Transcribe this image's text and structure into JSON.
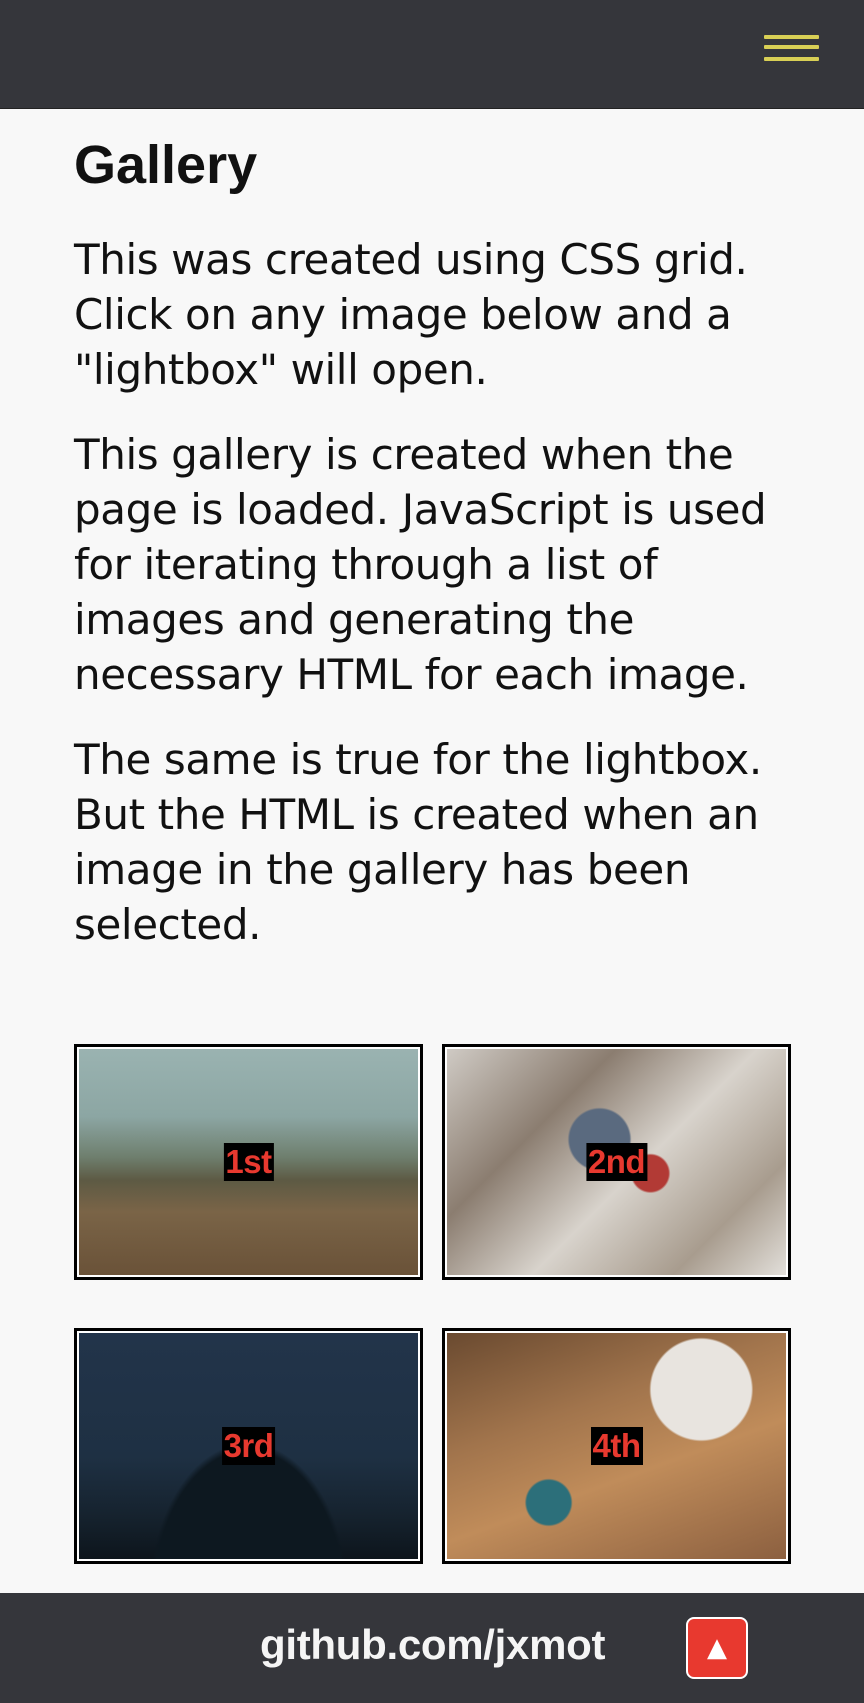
{
  "header": {
    "menu_icon": "hamburger-menu-icon",
    "menu_color": "#d8cf55",
    "background": "#35363b"
  },
  "main": {
    "title": "Gallery",
    "paragraphs": [
      "This was created using CSS grid. Click on any image below and a \"lightbox\" will open.",
      "This gallery is created when the page is loaded. JavaScript is used for iterating through a list of images and generating the necessary HTML for each image.",
      "The same is true for the lightbox. But the HTML is created when an image in the gallery has been selected."
    ]
  },
  "gallery": {
    "items": [
      {
        "caption": "1st"
      },
      {
        "caption": "2nd"
      },
      {
        "caption": "3rd"
      },
      {
        "caption": "4th"
      }
    ],
    "caption_color": "#e8392f"
  },
  "footer": {
    "link_text": "github.com/jxmot",
    "to_top_icon": "arrow-up-icon",
    "to_top_glyph": "▲",
    "to_top_color": "#e8392f"
  }
}
